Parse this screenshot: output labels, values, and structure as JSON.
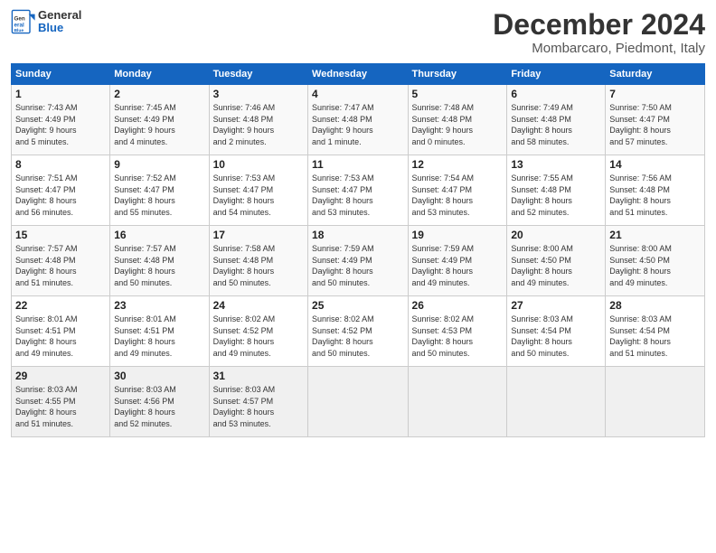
{
  "header": {
    "logo": {
      "general": "General",
      "blue": "Blue"
    },
    "title": "December 2024",
    "location": "Mombarcaro, Piedmont, Italy"
  },
  "calendar": {
    "days_of_week": [
      "Sunday",
      "Monday",
      "Tuesday",
      "Wednesday",
      "Thursday",
      "Friday",
      "Saturday"
    ],
    "weeks": [
      [
        {
          "day": "",
          "detail": ""
        },
        {
          "day": "2",
          "detail": "Sunrise: 7:45 AM\nSunset: 4:49 PM\nDaylight: 9 hours\nand 4 minutes."
        },
        {
          "day": "3",
          "detail": "Sunrise: 7:46 AM\nSunset: 4:48 PM\nDaylight: 9 hours\nand 2 minutes."
        },
        {
          "day": "4",
          "detail": "Sunrise: 7:47 AM\nSunset: 4:48 PM\nDaylight: 9 hours\nand 1 minute."
        },
        {
          "day": "5",
          "detail": "Sunrise: 7:48 AM\nSunset: 4:48 PM\nDaylight: 9 hours\nand 0 minutes."
        },
        {
          "day": "6",
          "detail": "Sunrise: 7:49 AM\nSunset: 4:48 PM\nDaylight: 8 hours\nand 58 minutes."
        },
        {
          "day": "7",
          "detail": "Sunrise: 7:50 AM\nSunset: 4:47 PM\nDaylight: 8 hours\nand 57 minutes."
        }
      ],
      [
        {
          "day": "8",
          "detail": "Sunrise: 7:51 AM\nSunset: 4:47 PM\nDaylight: 8 hours\nand 56 minutes."
        },
        {
          "day": "9",
          "detail": "Sunrise: 7:52 AM\nSunset: 4:47 PM\nDaylight: 8 hours\nand 55 minutes."
        },
        {
          "day": "10",
          "detail": "Sunrise: 7:53 AM\nSunset: 4:47 PM\nDaylight: 8 hours\nand 54 minutes."
        },
        {
          "day": "11",
          "detail": "Sunrise: 7:53 AM\nSunset: 4:47 PM\nDaylight: 8 hours\nand 53 minutes."
        },
        {
          "day": "12",
          "detail": "Sunrise: 7:54 AM\nSunset: 4:47 PM\nDaylight: 8 hours\nand 53 minutes."
        },
        {
          "day": "13",
          "detail": "Sunrise: 7:55 AM\nSunset: 4:48 PM\nDaylight: 8 hours\nand 52 minutes."
        },
        {
          "day": "14",
          "detail": "Sunrise: 7:56 AM\nSunset: 4:48 PM\nDaylight: 8 hours\nand 51 minutes."
        }
      ],
      [
        {
          "day": "15",
          "detail": "Sunrise: 7:57 AM\nSunset: 4:48 PM\nDaylight: 8 hours\nand 51 minutes."
        },
        {
          "day": "16",
          "detail": "Sunrise: 7:57 AM\nSunset: 4:48 PM\nDaylight: 8 hours\nand 50 minutes."
        },
        {
          "day": "17",
          "detail": "Sunrise: 7:58 AM\nSunset: 4:48 PM\nDaylight: 8 hours\nand 50 minutes."
        },
        {
          "day": "18",
          "detail": "Sunrise: 7:59 AM\nSunset: 4:49 PM\nDaylight: 8 hours\nand 50 minutes."
        },
        {
          "day": "19",
          "detail": "Sunrise: 7:59 AM\nSunset: 4:49 PM\nDaylight: 8 hours\nand 49 minutes."
        },
        {
          "day": "20",
          "detail": "Sunrise: 8:00 AM\nSunset: 4:50 PM\nDaylight: 8 hours\nand 49 minutes."
        },
        {
          "day": "21",
          "detail": "Sunrise: 8:00 AM\nSunset: 4:50 PM\nDaylight: 8 hours\nand 49 minutes."
        }
      ],
      [
        {
          "day": "22",
          "detail": "Sunrise: 8:01 AM\nSunset: 4:51 PM\nDaylight: 8 hours\nand 49 minutes."
        },
        {
          "day": "23",
          "detail": "Sunrise: 8:01 AM\nSunset: 4:51 PM\nDaylight: 8 hours\nand 49 minutes."
        },
        {
          "day": "24",
          "detail": "Sunrise: 8:02 AM\nSunset: 4:52 PM\nDaylight: 8 hours\nand 49 minutes."
        },
        {
          "day": "25",
          "detail": "Sunrise: 8:02 AM\nSunset: 4:52 PM\nDaylight: 8 hours\nand 50 minutes."
        },
        {
          "day": "26",
          "detail": "Sunrise: 8:02 AM\nSunset: 4:53 PM\nDaylight: 8 hours\nand 50 minutes."
        },
        {
          "day": "27",
          "detail": "Sunrise: 8:03 AM\nSunset: 4:54 PM\nDaylight: 8 hours\nand 50 minutes."
        },
        {
          "day": "28",
          "detail": "Sunrise: 8:03 AM\nSunset: 4:54 PM\nDaylight: 8 hours\nand 51 minutes."
        }
      ],
      [
        {
          "day": "29",
          "detail": "Sunrise: 8:03 AM\nSunset: 4:55 PM\nDaylight: 8 hours\nand 51 minutes."
        },
        {
          "day": "30",
          "detail": "Sunrise: 8:03 AM\nSunset: 4:56 PM\nDaylight: 8 hours\nand 52 minutes."
        },
        {
          "day": "31",
          "detail": "Sunrise: 8:03 AM\nSunset: 4:57 PM\nDaylight: 8 hours\nand 53 minutes."
        },
        {
          "day": "",
          "detail": ""
        },
        {
          "day": "",
          "detail": ""
        },
        {
          "day": "",
          "detail": ""
        },
        {
          "day": "",
          "detail": ""
        }
      ]
    ],
    "week1_day1": {
      "day": "1",
      "detail": "Sunrise: 7:43 AM\nSunset: 4:49 PM\nDaylight: 9 hours\nand 5 minutes."
    }
  }
}
